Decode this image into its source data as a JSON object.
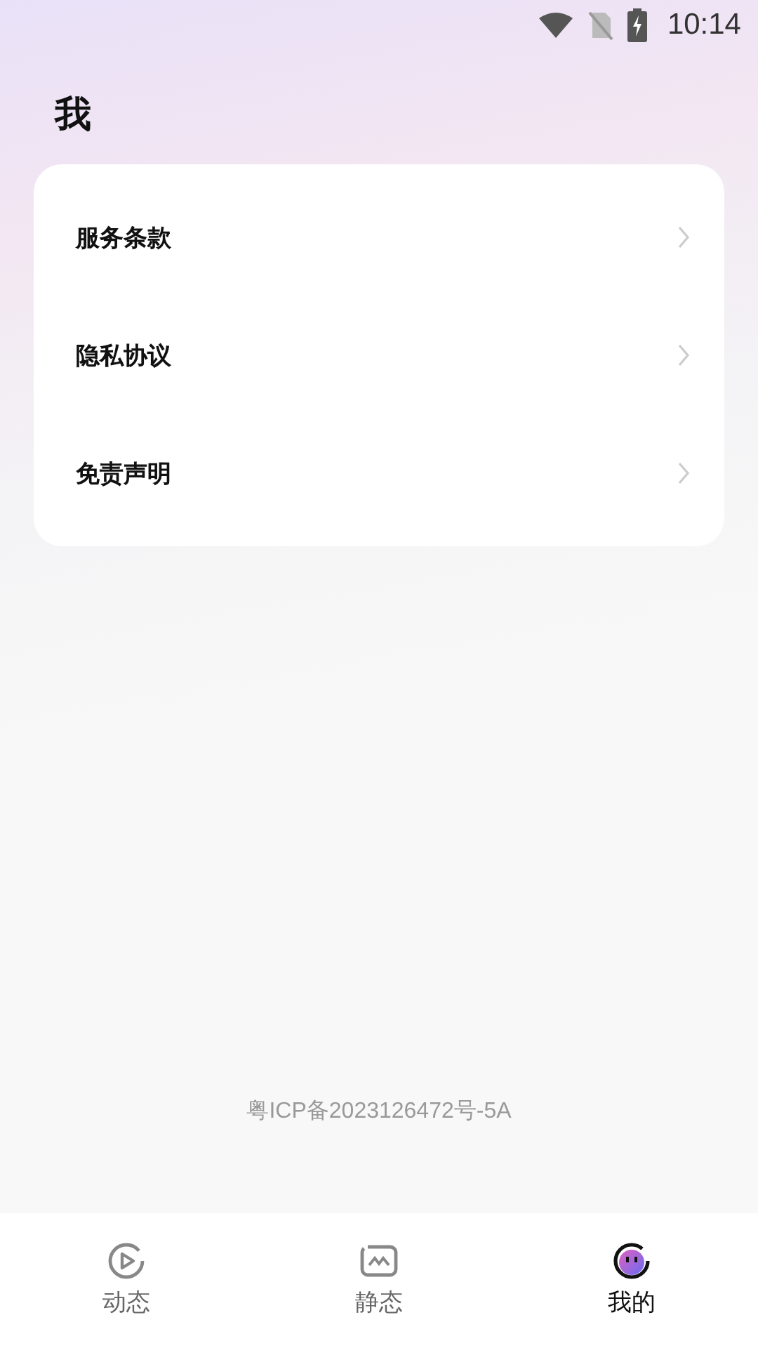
{
  "status_bar": {
    "time": "10:14"
  },
  "title": "我",
  "menu": [
    {
      "label": "服务条款"
    },
    {
      "label": "隐私协议"
    },
    {
      "label": "免责声明"
    }
  ],
  "footer": "粤ICP备2023126472号-5A",
  "tabs": [
    {
      "label": "动态",
      "kind": "play",
      "selected": false
    },
    {
      "label": "静态",
      "kind": "image",
      "selected": false
    },
    {
      "label": "我的",
      "kind": "face",
      "selected": true
    }
  ]
}
